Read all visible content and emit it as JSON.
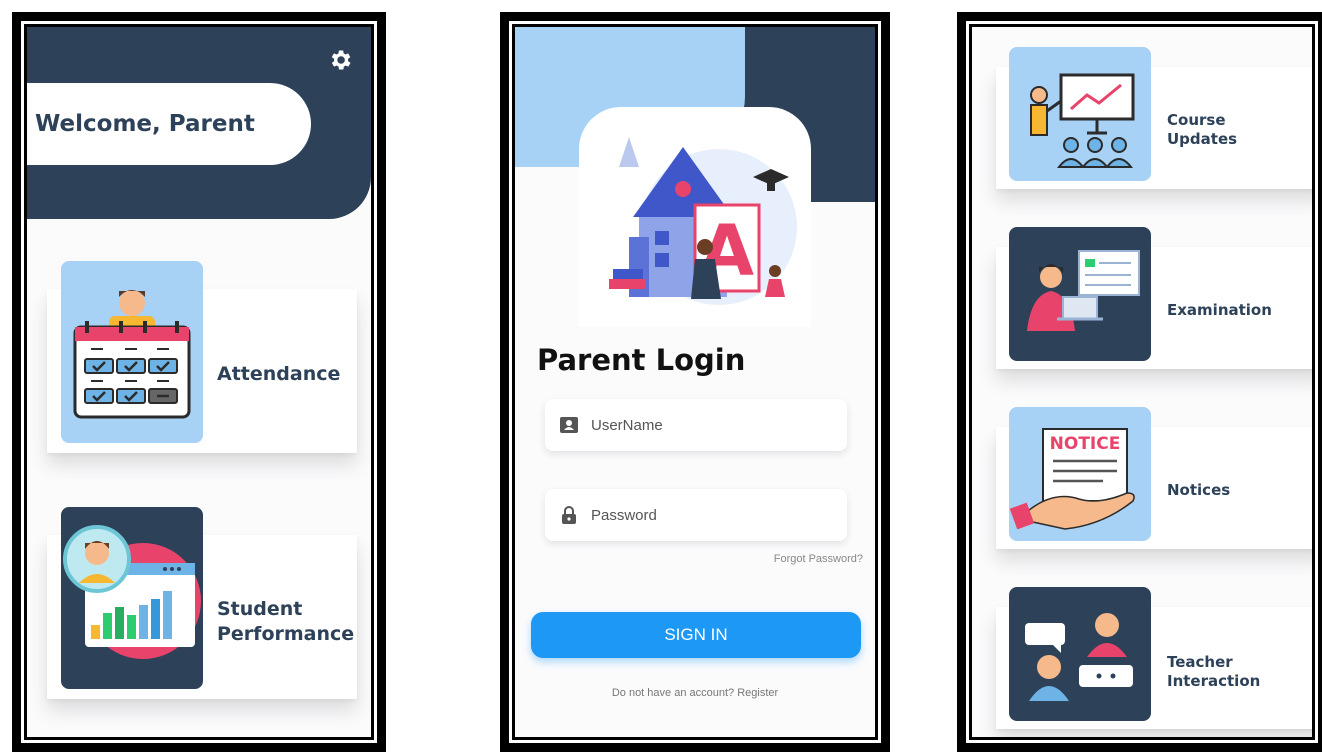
{
  "screen_home": {
    "welcome": "Welcome, Parent",
    "settings_icon": "gear-icon",
    "menu": [
      {
        "label": "Attendance",
        "icon": "attendance-calendar-icon"
      },
      {
        "label_lines": [
          "Student",
          "Performance"
        ],
        "icon": "student-performance-chart-icon"
      }
    ]
  },
  "screen_login": {
    "title": "Parent Login",
    "username_placeholder": "UserName",
    "password_placeholder": "Password",
    "forgot_password": "Forgot Password?",
    "sign_in": "SIGN IN",
    "register_prompt": "Do not have an account? Register",
    "illustration_letter": "A"
  },
  "screen_features": {
    "menu": [
      {
        "label_lines": [
          "Course",
          "Updates"
        ],
        "icon": "course-updates-icon"
      },
      {
        "label_lines": [
          "Examination"
        ],
        "icon": "examination-icon"
      },
      {
        "label_lines": [
          "Notices"
        ],
        "icon": "notice-icon",
        "icon_text": "NOTICE"
      },
      {
        "label_lines": [
          "Teacher",
          "Interaction"
        ],
        "icon": "teacher-interaction-icon"
      }
    ]
  },
  "colors": {
    "navy": "#2d4159",
    "light_blue": "#a7d2f5",
    "primary_button": "#1e98f5",
    "accent_pink": "#e8436a"
  }
}
